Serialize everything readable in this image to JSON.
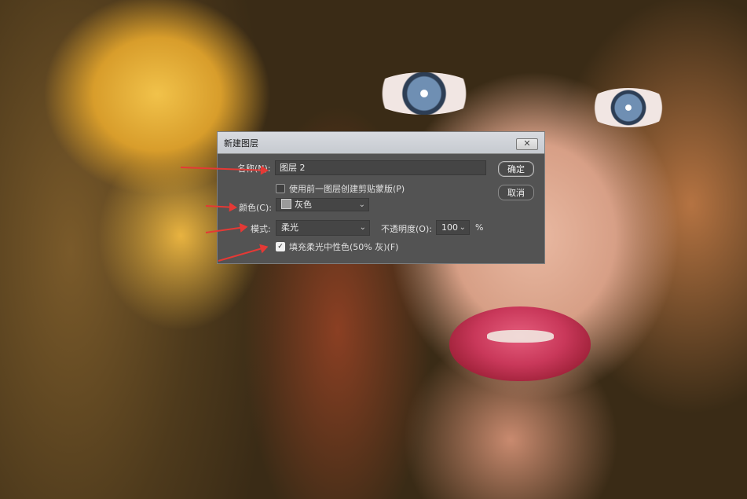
{
  "dialog": {
    "title": "新建图层",
    "close_icon": "close-x-icon",
    "name_label": "名称(N):",
    "name_value": "图层 2",
    "clip_checkbox_label": "使用前一图层创建剪贴蒙版(P)",
    "clip_checked": false,
    "color_label": "颜色(C):",
    "color_value": "灰色",
    "color_swatch": "#9b9b9b",
    "mode_label": "模式:",
    "mode_value": "柔光",
    "opacity_label": "不透明度(O):",
    "opacity_value": "100",
    "opacity_unit": "%",
    "fill_checkbox_label": "填充柔光中性色(50% 灰)(F)",
    "fill_checked": true,
    "ok_label": "确定",
    "cancel_label": "取消"
  },
  "annotation": {
    "arrow_color": "#e53935"
  }
}
